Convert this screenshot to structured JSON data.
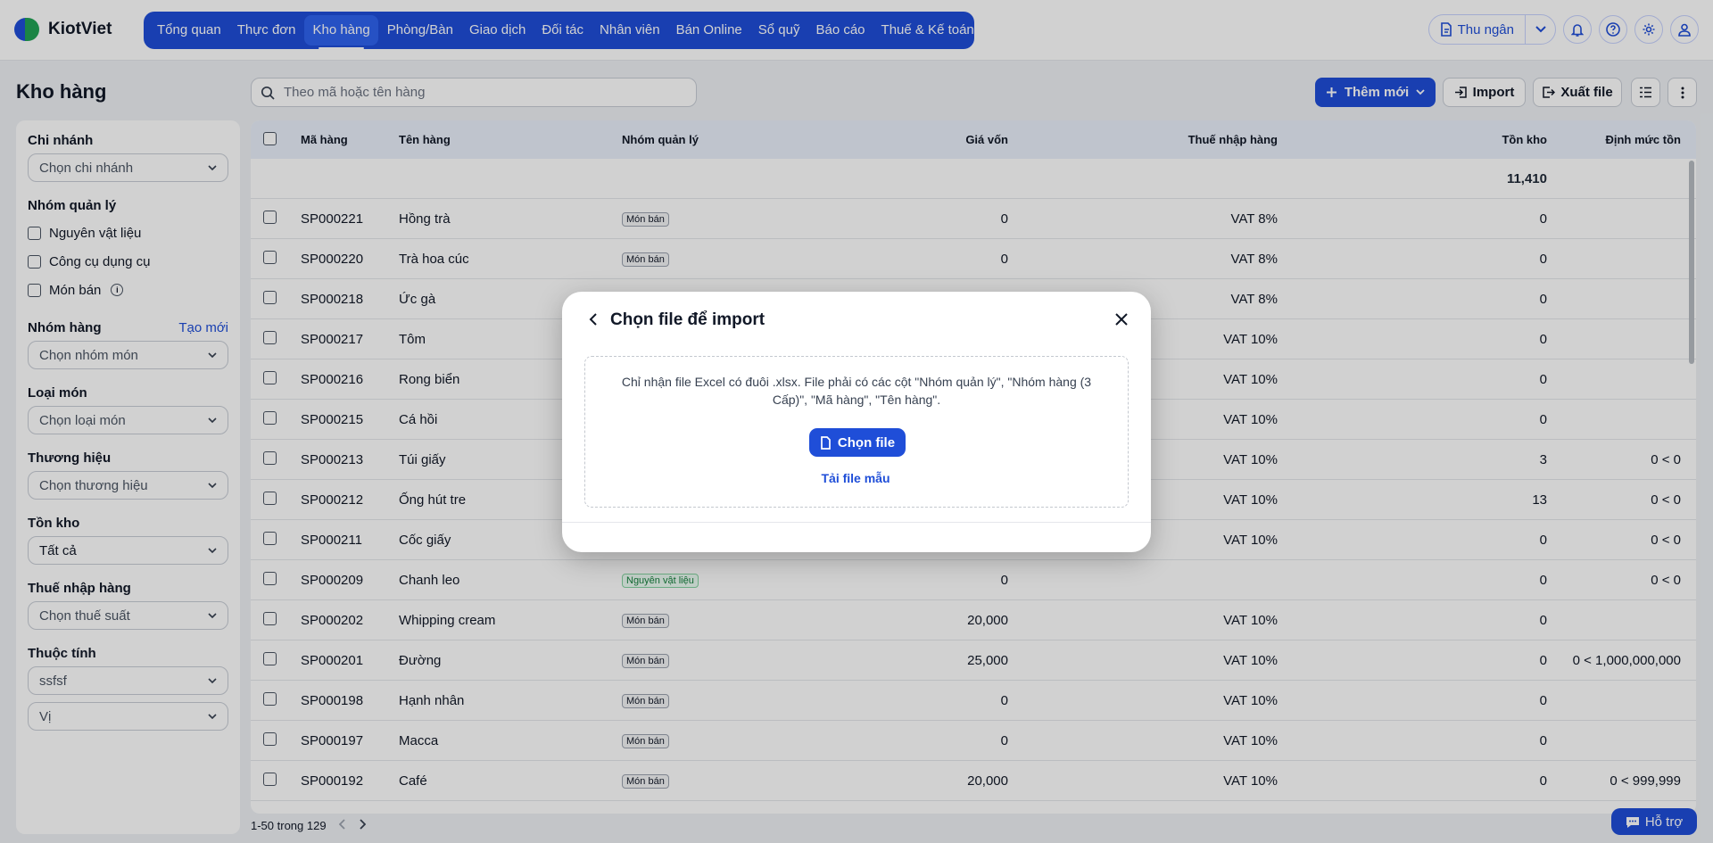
{
  "app": {
    "logo_text": "KiotViet",
    "nav": [
      {
        "label": "Tổng quan"
      },
      {
        "label": "Thực đơn"
      },
      {
        "label": "Kho hàng"
      },
      {
        "label": "Phòng/Bàn"
      },
      {
        "label": "Giao dịch"
      },
      {
        "label": "Đối tác"
      },
      {
        "label": "Nhân viên"
      },
      {
        "label": "Bán Online"
      },
      {
        "label": "Sổ quỹ"
      },
      {
        "label": "Báo cáo"
      },
      {
        "label": "Thuế & Kế toán"
      }
    ],
    "active_nav": "Kho hàng",
    "cashier_label": "Thu ngân"
  },
  "page": {
    "title": "Kho hàng",
    "search_placeholder": "Theo mã hoặc tên hàng",
    "add_label": "Thêm mới",
    "import_label": "Import",
    "export_label": "Xuất file"
  },
  "sidebar": {
    "branch": {
      "label": "Chi nhánh",
      "placeholder": "Chọn chi nhánh"
    },
    "manage_group": {
      "label": "Nhóm quản lý",
      "options": [
        "Nguyên vật liệu",
        "Công cụ dụng cụ",
        "Món bán"
      ]
    },
    "item_group": {
      "label": "Nhóm hàng",
      "link": "Tạo mới",
      "placeholder": "Chọn nhóm món"
    },
    "item_type": {
      "label": "Loại món",
      "placeholder": "Chọn loại món"
    },
    "brand": {
      "label": "Thương hiệu",
      "placeholder": "Chọn thương hiệu"
    },
    "stock": {
      "label": "Tồn kho",
      "value": "Tất cả"
    },
    "import_tax": {
      "label": "Thuế nhập hàng",
      "placeholder": "Chọn thuế suất"
    },
    "attributes": {
      "label": "Thuộc tính",
      "values": [
        "ssfsf",
        "Vị"
      ]
    }
  },
  "table": {
    "headers": {
      "code": "Mã hàng",
      "name": "Tên hàng",
      "group": "Nhóm quản lý",
      "cost": "Giá vốn",
      "tax": "Thuế nhập hàng",
      "stock": "Tồn kho",
      "min": "Định mức tồn"
    },
    "total_stock": "11,410",
    "rows": [
      {
        "code": "SP000221",
        "name": "Hồng trà",
        "group": "Món bán",
        "cost": "0",
        "tax": "VAT 8%",
        "stock": "0",
        "min": ""
      },
      {
        "code": "SP000220",
        "name": "Trà hoa cúc",
        "group": "Món bán",
        "cost": "0",
        "tax": "VAT 8%",
        "stock": "0",
        "min": ""
      },
      {
        "code": "SP000218",
        "name": "Ức gà",
        "group": "",
        "cost": "",
        "tax": "VAT 8%",
        "stock": "0",
        "min": ""
      },
      {
        "code": "SP000217",
        "name": "Tôm",
        "group": "",
        "cost": "",
        "tax": "VAT 10%",
        "stock": "0",
        "min": ""
      },
      {
        "code": "SP000216",
        "name": "Rong biển",
        "group": "",
        "cost": "",
        "tax": "VAT 10%",
        "stock": "0",
        "min": ""
      },
      {
        "code": "SP000215",
        "name": "Cá hồi",
        "group": "",
        "cost": "",
        "tax": "VAT 10%",
        "stock": "0",
        "min": ""
      },
      {
        "code": "SP000213",
        "name": "Túi giấy",
        "group": "",
        "cost": "",
        "tax": "VAT 10%",
        "stock": "3",
        "min": "0 < 0"
      },
      {
        "code": "SP000212",
        "name": "Ống hút tre",
        "group": "",
        "cost": "",
        "tax": "VAT 10%",
        "stock": "13",
        "min": "0 < 0"
      },
      {
        "code": "SP000211",
        "name": "Cốc giấy",
        "group": "",
        "cost": "",
        "tax": "VAT 10%",
        "stock": "0",
        "min": "0 < 0"
      },
      {
        "code": "SP000209",
        "name": "Chanh leo",
        "group": "Nguyên vật liệu",
        "cost": "0",
        "tax": "",
        "stock": "0",
        "min": "0 < 0"
      },
      {
        "code": "SP000202",
        "name": "Whipping cream",
        "group": "Món bán",
        "cost": "20,000",
        "tax": "VAT 10%",
        "stock": "0",
        "min": ""
      },
      {
        "code": "SP000201",
        "name": "Đường",
        "group": "Món bán",
        "cost": "25,000",
        "tax": "VAT 10%",
        "stock": "0",
        "min": "0 < 1,000,000,000"
      },
      {
        "code": "SP000198",
        "name": "Hạnh nhân",
        "group": "Món bán",
        "cost": "0",
        "tax": "VAT 10%",
        "stock": "0",
        "min": ""
      },
      {
        "code": "SP000197",
        "name": "Macca",
        "group": "Món bán",
        "cost": "0",
        "tax": "VAT 10%",
        "stock": "0",
        "min": ""
      },
      {
        "code": "SP000192",
        "name": "Café",
        "group": "Món bán",
        "cost": "20,000",
        "tax": "VAT 10%",
        "stock": "0",
        "min": "0 < 999,999"
      }
    ],
    "pager_text": "1-50 trong 129"
  },
  "support_label": "Hỗ trợ",
  "modal": {
    "title": "Chọn file để import",
    "description": "Chỉ nhận file Excel có đuôi .xlsx. File phải có các cột \"Nhóm quản lý\", \"Nhóm hàng (3 Cấp)\", \"Mã hàng\", \"Tên hàng\".",
    "choose_label": "Chọn file",
    "sample_label": "Tải file mẫu"
  },
  "colors": {
    "brand_blue": "#1f4ed8",
    "brand_green": "#22a355"
  }
}
